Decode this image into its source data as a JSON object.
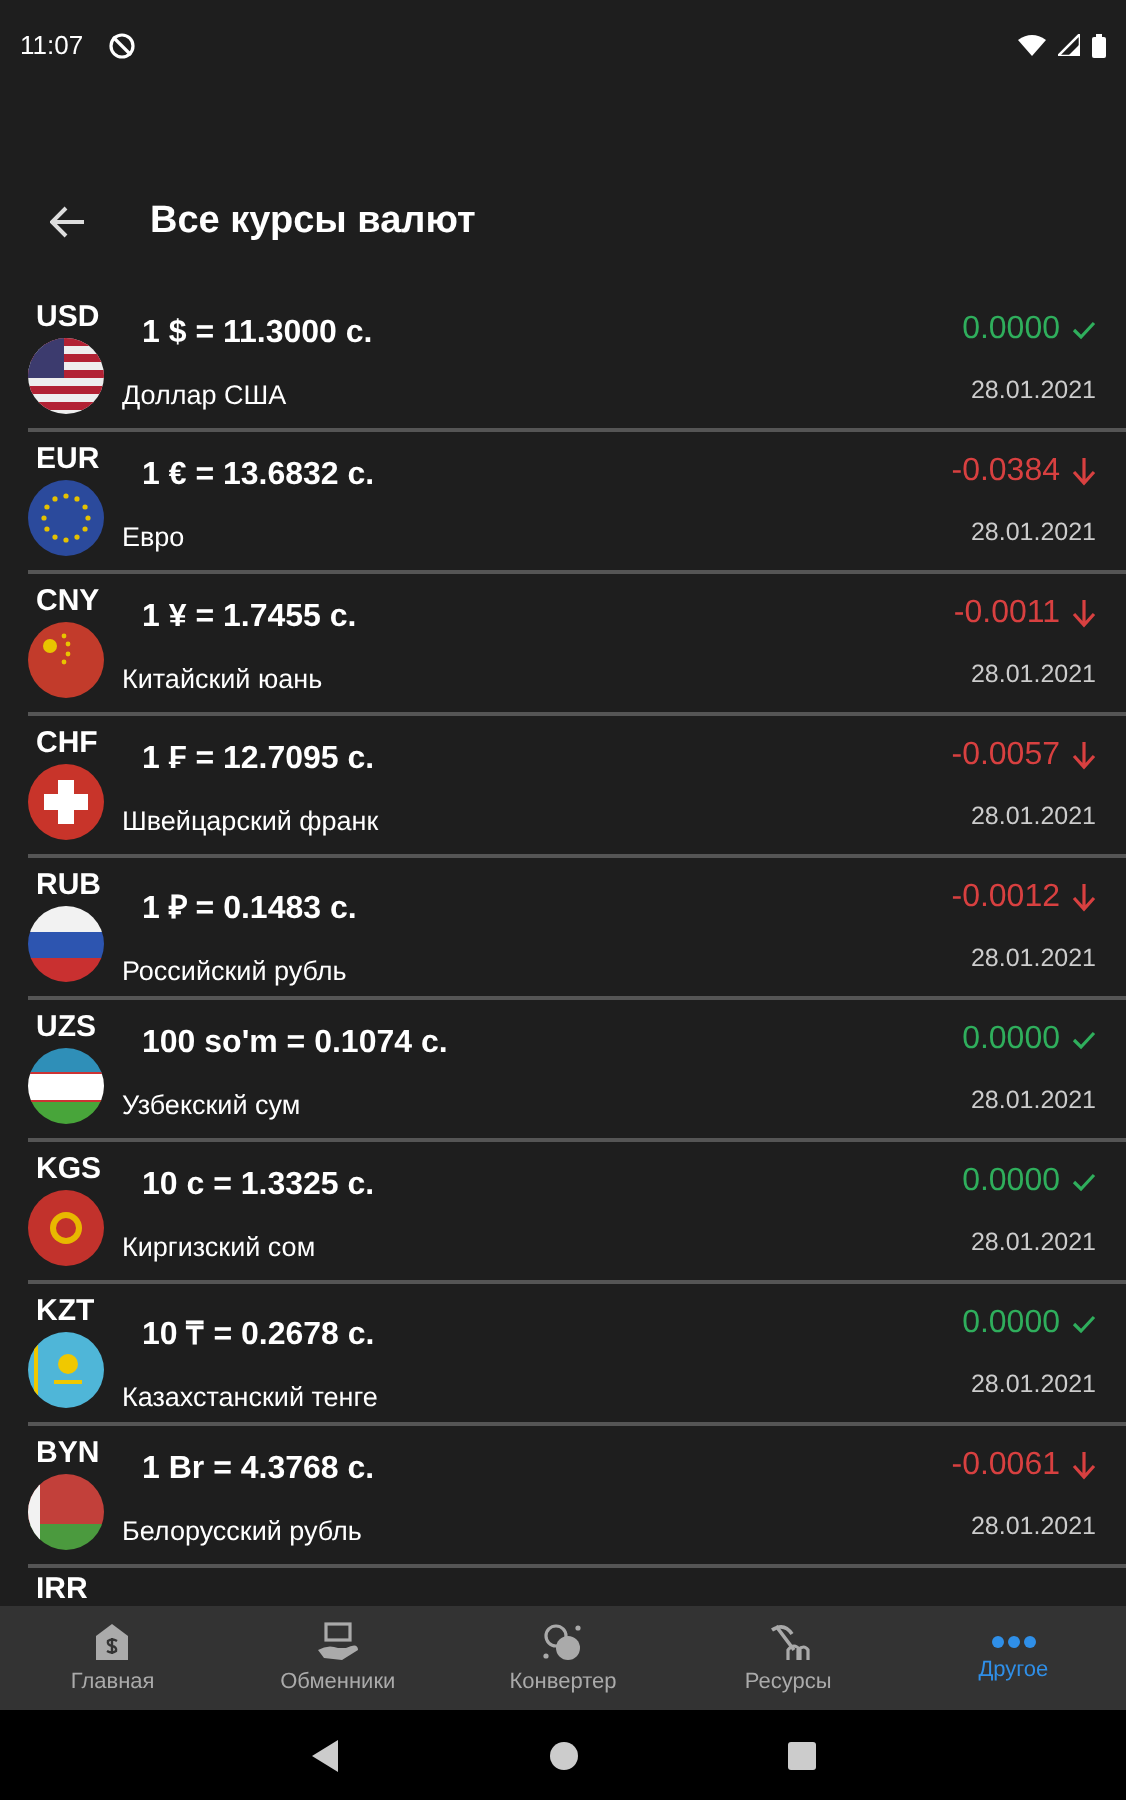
{
  "status_bar": {
    "time": "11:07"
  },
  "app_bar": {
    "title": "Все курсы валют"
  },
  "rates": [
    {
      "code": "USD",
      "rate": "1 $ = 11.3000 с.",
      "name": "Доллар США",
      "change": "0.0000",
      "kind": "unchanged",
      "date": "28.01.2021"
    },
    {
      "code": "EUR",
      "rate": "1 € = 13.6832 с.",
      "name": "Евро",
      "change": "-0.0384",
      "kind": "down",
      "date": "28.01.2021"
    },
    {
      "code": "CNY",
      "rate": "1 ¥ = 1.7455 с.",
      "name": "Китайский юань",
      "change": "-0.0011",
      "kind": "down",
      "date": "28.01.2021"
    },
    {
      "code": "CHF",
      "rate": "1 ₣ = 12.7095 с.",
      "name": "Швейцарский франк",
      "change": "-0.0057",
      "kind": "down",
      "date": "28.01.2021"
    },
    {
      "code": "RUB",
      "rate": "1 ₽ = 0.1483 с.",
      "name": "Российский рубль",
      "change": "-0.0012",
      "kind": "down",
      "date": "28.01.2021"
    },
    {
      "code": "UZS",
      "rate": "100 so'm = 0.1074 с.",
      "name": "Узбекский сум",
      "change": "0.0000",
      "kind": "unchanged",
      "date": "28.01.2021"
    },
    {
      "code": "KGS",
      "rate": "10 с = 1.3325 с.",
      "name": "Киргизский сом",
      "change": "0.0000",
      "kind": "unchanged",
      "date": "28.01.2021"
    },
    {
      "code": "KZT",
      "rate": "10 ₸ = 0.2678 с.",
      "name": "Казахстанский тенге",
      "change": "0.0000",
      "kind": "unchanged",
      "date": "28.01.2021"
    },
    {
      "code": "BYN",
      "rate": "1 Br = 4.3768 с.",
      "name": "Белорусский рубль",
      "change": "-0.0061",
      "kind": "down",
      "date": "28.01.2021"
    }
  ],
  "partial_row": {
    "code": "IRR"
  },
  "bottom_nav": [
    {
      "label": "Главная",
      "selected": false
    },
    {
      "label": "Обменники",
      "selected": false
    },
    {
      "label": "Конвертер",
      "selected": false
    },
    {
      "label": "Ресурсы",
      "selected": false
    },
    {
      "label": "Другое",
      "selected": true
    }
  ]
}
